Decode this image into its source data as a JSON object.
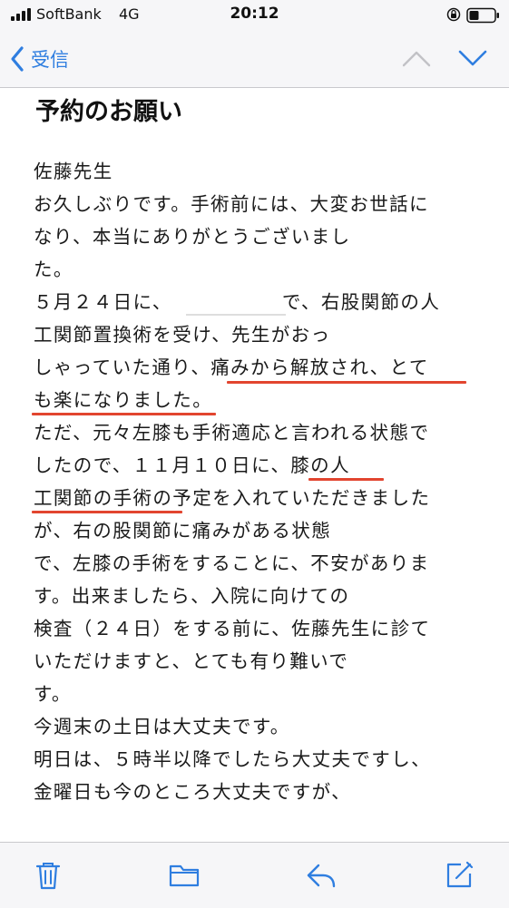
{
  "status_bar": {
    "carrier": "SoftBank",
    "network": "4G",
    "time": "20:12"
  },
  "nav": {
    "back_label": "受信",
    "icons": [
      "chevron-left-icon",
      "chevron-up-icon",
      "chevron-down-icon"
    ]
  },
  "message": {
    "subject": "予約のお願い",
    "lines": [
      "佐藤先生",
      "お久しぶりです。手術前には、大変お世話に",
      "なり、本当にありがとうございまし",
      "た。",
      "５月２４日に、　　　　　　で、右股関節の人",
      "工関節置換術を受け、先生がおっ",
      "しゃっていた通り、痛みから解放され、とて",
      "も楽になりました。",
      "ただ、元々左膝も手術適応と言われる状態で",
      "したので、１１月１０日に、膝の人",
      "工関節の手術の予定を入れていただきました",
      "が、右の股関節に痛みがある状態",
      "で、左膝の手術をすることに、不安がありま",
      "す。出来ましたら、入院に向けての",
      "検査（２４日）をする前に、佐藤先生に診て",
      "いただけますと、とても有り難いで",
      "す。",
      "今週末の土日は大丈夫です。",
      "明日は、５時半以降でしたら大丈夫ですし、",
      "金曜日も今のところ大丈夫ですが、"
    ]
  },
  "toolbar": {
    "icons": [
      "trash-icon",
      "folder-icon",
      "reply-icon",
      "compose-icon"
    ]
  },
  "colors": {
    "accent": "#2f7ee0",
    "underline": "#e2452f",
    "bar_background": "#f6f6f8"
  }
}
